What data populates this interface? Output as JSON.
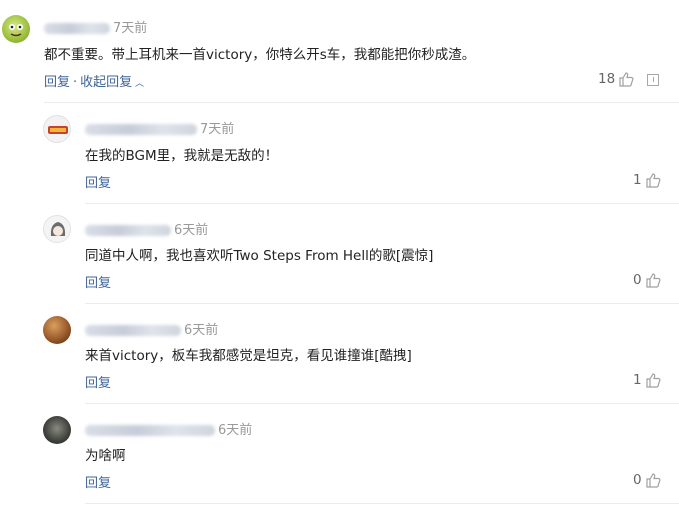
{
  "comments": [
    {
      "name_blur": true,
      "time": "7天前",
      "text": "都不重要。带上耳机来一首victory，你特么开s车，我都能把你秒成渣。",
      "reply_label": "回复",
      "dot": "·",
      "collapse_label": "收起回复",
      "likes": "18",
      "avatar": "green-frog-avatar"
    },
    {
      "name_blur": true,
      "time": "7天前",
      "text": "在我的BGM里，我就是无敌的！",
      "reply_label": "回复",
      "likes": "1",
      "avatar": "game-logo-avatar"
    },
    {
      "name_blur": true,
      "time": "6天前",
      "text": "同道中人啊，我也喜欢听Two Steps From Hell的歌[震惊]",
      "reply_label": "回复",
      "likes": "0",
      "avatar": "anime-girl-avatar"
    },
    {
      "name_blur": true,
      "time": "6天前",
      "text": "来首victory，板车我都感觉是坦克，看见谁撞谁[酷拽]",
      "reply_label": "回复",
      "likes": "1",
      "avatar": "brown-photo-avatar"
    },
    {
      "name_blur": true,
      "time": "6天前",
      "text": "为啥啊",
      "reply_label": "回复",
      "likes": "0",
      "avatar": "dark-photo-avatar"
    }
  ],
  "colors": {
    "link": "#406599",
    "meta": "#999999",
    "text": "#222222"
  }
}
